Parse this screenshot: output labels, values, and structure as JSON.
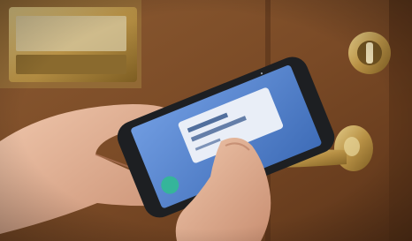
{
  "scene": {
    "description_icon": "photo",
    "colors": {
      "door_wood": "#7a4a26",
      "door_dark": "#4e2c15",
      "brass": "#b99246",
      "brass_light": "#dcc27a",
      "phone_body": "#1d1f22",
      "screen_blue": "#5a86cf",
      "card_white": "#e9eef7",
      "skin": "#e4b79a",
      "skin_shadow": "#c98f72",
      "fab_green": "#35b59a"
    }
  },
  "phone_screen": {
    "lines": [
      "",
      ""
    ]
  }
}
